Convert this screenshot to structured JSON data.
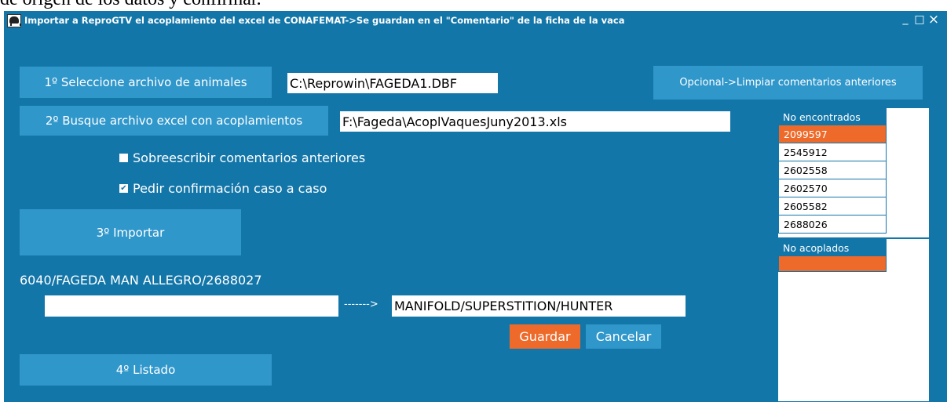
{
  "document": {
    "top_text": "de origen de los datos y confirmar."
  },
  "window": {
    "title": "Importar a ReproGTV el acoplamiento del excel de CONAFEMAT->Se guardan en el \"Comentario\" de la ficha de la vaca",
    "minimize": "_",
    "maximize": "□",
    "close": "×"
  },
  "step1": {
    "button": "1º Seleccione archivo de animales",
    "path": "C:\\Reprowin\\FAGEDA1.DBF"
  },
  "step2": {
    "button": "2º Busque archivo excel con acoplamientos",
    "path": "F:\\Fageda\\AcoplVaquesJuny2013.xls"
  },
  "options": {
    "clear_button": "Opcional->Limpiar comentarios anteriores",
    "overwrite": {
      "label": "Sobreescribir comentarios anteriores",
      "checked": false
    },
    "confirm": {
      "label": "Pedir confirmación caso a caso",
      "checked": true,
      "mark": "✔"
    }
  },
  "step3": {
    "button": "3º Importar"
  },
  "current": {
    "animal": "6040/FAGEDA MAN ALLEGRO/2688027",
    "edit_value": "",
    "arrow": "------->",
    "mating": "MANIFOLD/SUPERSTITION/HUNTER",
    "save": "Guardar",
    "cancel": "Cancelar"
  },
  "step4": {
    "button": "4º Listado"
  },
  "not_found": {
    "header": "No encontrados",
    "items": [
      "2099597",
      "2545912",
      "2602558",
      "2602570",
      "2605582",
      "2688026"
    ],
    "selected_index": 0
  },
  "not_mated": {
    "header": "No acoplados",
    "items": [
      ""
    ]
  },
  "colors": {
    "window_bg": "#1376a9",
    "button_bg": "#3097cb",
    "accent": "#ee6a2a"
  }
}
